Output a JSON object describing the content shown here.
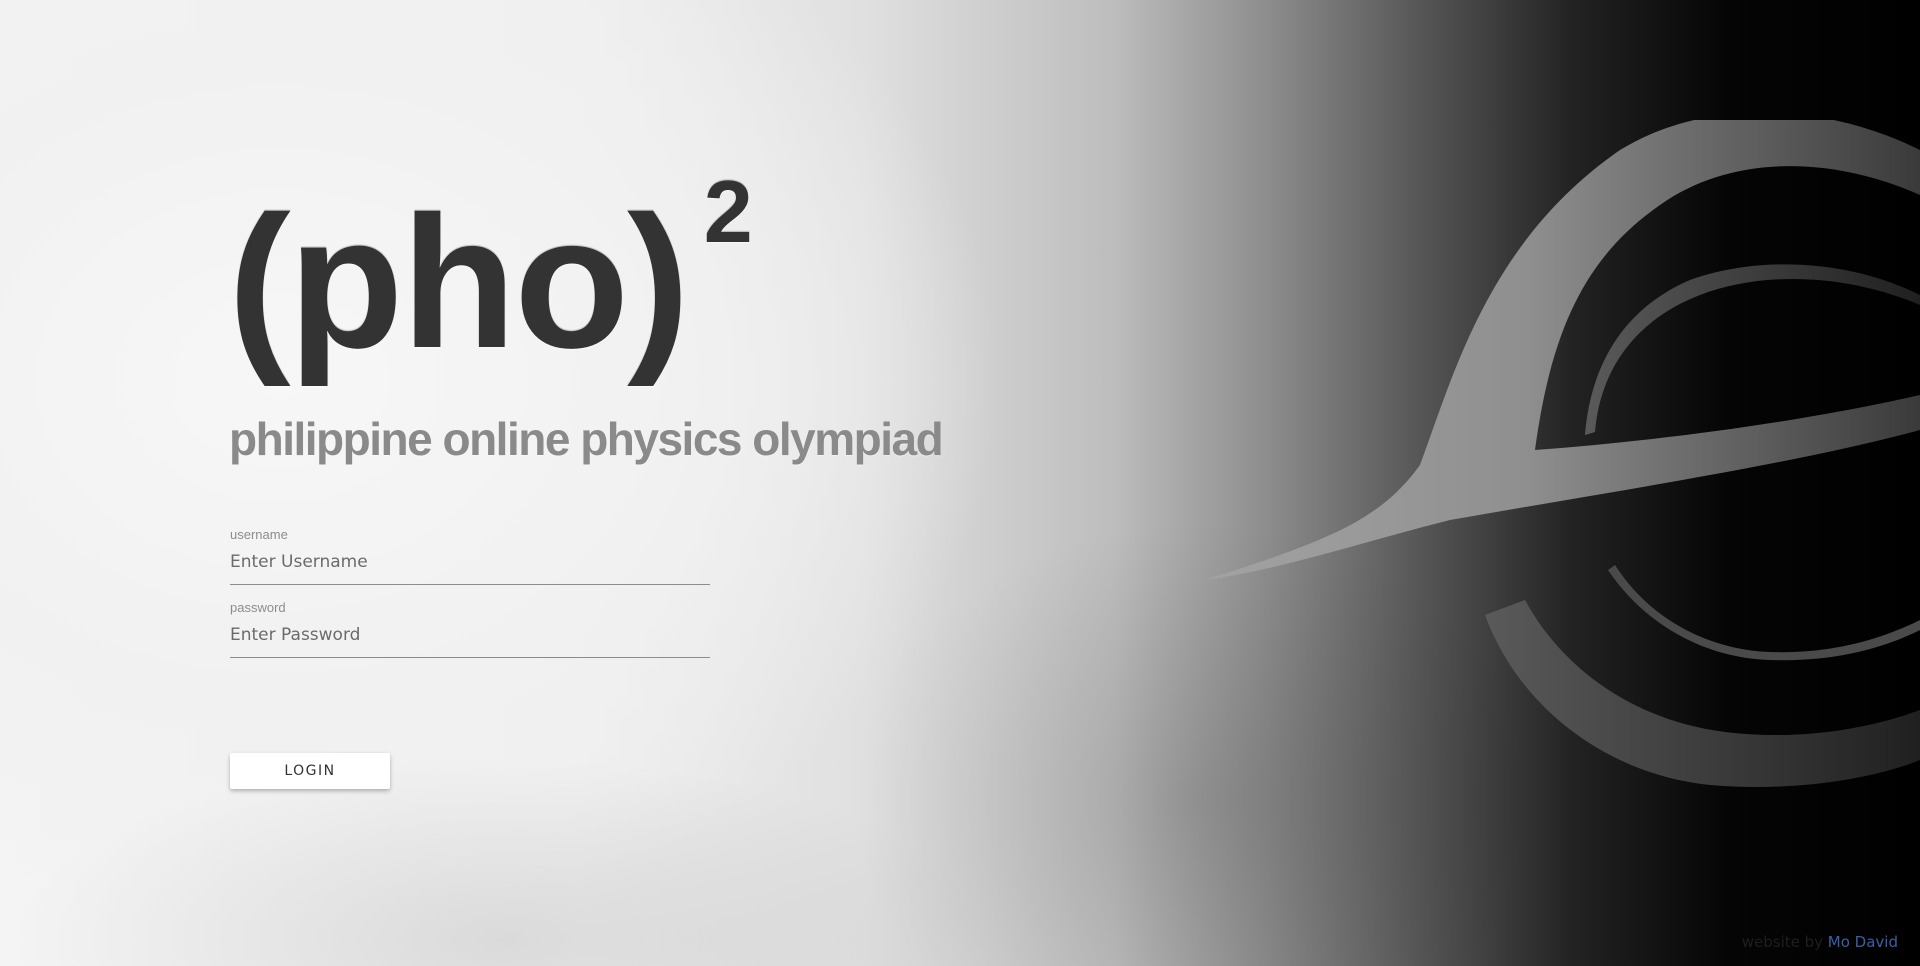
{
  "brand": {
    "logo_text": "(pho)",
    "logo_superscript": "2",
    "subtitle": "philippine online physics olympiad"
  },
  "login_form": {
    "username": {
      "label": "username",
      "placeholder": "Enter Username",
      "value": ""
    },
    "password": {
      "label": "password",
      "placeholder": "Enter Password",
      "value": ""
    },
    "login_label": "LOGIN"
  },
  "footer": {
    "credit_prefix": "website by",
    "credit_author": "Mo David"
  },
  "colors": {
    "logo": "#333333",
    "subtitle": "#8a8a8a",
    "credit_link": "#3a5fa6",
    "background_light": "#f2f2f2",
    "background_dark": "#000000",
    "emblem": "#9a9a9a"
  },
  "icons": {
    "emblem": "physics-olympiad-emblem-icon"
  }
}
